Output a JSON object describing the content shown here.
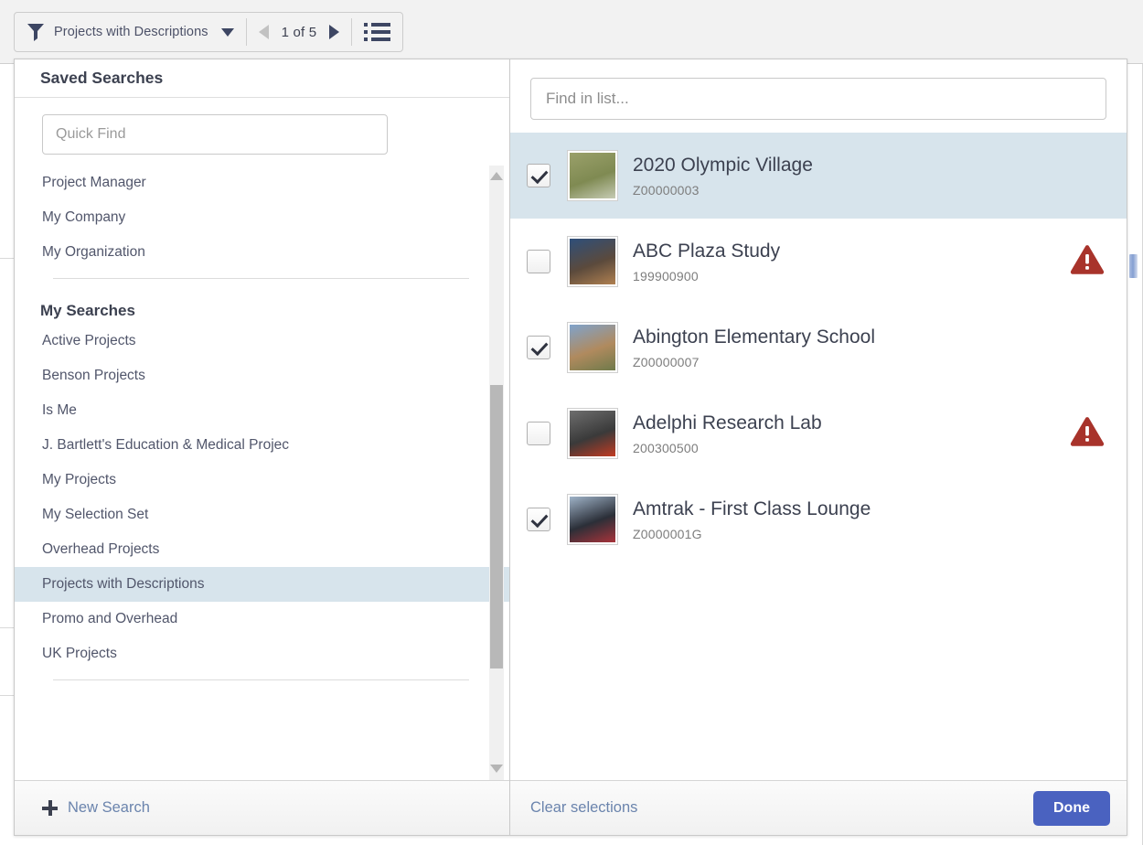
{
  "toolbar": {
    "filter_icon": "funnel-icon",
    "filter_label": "Projects with Descriptions",
    "dropdown_icon": "chevron-down-icon",
    "prev_icon": "triangle-left-icon",
    "page_indicator": "1 of 5",
    "next_icon": "triangle-right-icon",
    "list_view_icon": "list-view-icon"
  },
  "left_panel": {
    "header": "Saved Searches",
    "quick_find_placeholder": "Quick Find",
    "quick_find_value": "",
    "items": [
      {
        "label": "Project Manager",
        "type": "item",
        "selected": false
      },
      {
        "label": "My Company",
        "type": "item",
        "selected": false
      },
      {
        "label": "My Organization",
        "type": "item",
        "selected": false
      },
      {
        "label": "",
        "type": "divider",
        "selected": false
      },
      {
        "label": "My Searches",
        "type": "group",
        "selected": false
      },
      {
        "label": "Active Projects",
        "type": "item",
        "selected": false
      },
      {
        "label": "Benson Projects",
        "type": "item",
        "selected": false
      },
      {
        "label": "Is Me",
        "type": "item",
        "selected": false
      },
      {
        "label": "J. Bartlett's Education & Medical Projec",
        "type": "item",
        "selected": false
      },
      {
        "label": "My Projects",
        "type": "item",
        "selected": false
      },
      {
        "label": "My Selection Set",
        "type": "item",
        "selected": false
      },
      {
        "label": "Overhead Projects",
        "type": "item",
        "selected": false
      },
      {
        "label": "Projects with Descriptions",
        "type": "item",
        "selected": true
      },
      {
        "label": "Promo and Overhead",
        "type": "item",
        "selected": false
      },
      {
        "label": "UK Projects",
        "type": "item",
        "selected": false
      },
      {
        "label": "",
        "type": "divider",
        "selected": false
      }
    ],
    "footer": {
      "icon": "plus-icon",
      "label": "New Search"
    }
  },
  "right_panel": {
    "find_placeholder": "Find in list...",
    "find_value": "",
    "rows": [
      {
        "title": "2020 Olympic Village",
        "id": "Z00000003",
        "checked": true,
        "highlighted": true,
        "warning": false,
        "thumb_colors": [
          "#9aa06a",
          "#7f8a52",
          "#c6cbb4"
        ]
      },
      {
        "title": "ABC Plaza Study",
        "id": "199900900",
        "checked": false,
        "highlighted": false,
        "warning": true,
        "thumb_colors": [
          "#2e4f7a",
          "#5b4a3c",
          "#b08050"
        ]
      },
      {
        "title": "Abington Elementary School",
        "id": "Z00000007",
        "checked": true,
        "highlighted": false,
        "warning": false,
        "thumb_colors": [
          "#7fa3cc",
          "#b08a5e",
          "#6f7a4a"
        ]
      },
      {
        "title": "Adelphi Research Lab",
        "id": "200300500",
        "checked": false,
        "highlighted": false,
        "warning": true,
        "thumb_colors": [
          "#6e6e6e",
          "#3a3a3a",
          "#c23b22"
        ]
      },
      {
        "title": "Amtrak - First Class Lounge",
        "id": "Z0000001G",
        "checked": true,
        "highlighted": false,
        "warning": false,
        "thumb_colors": [
          "#9fb3c8",
          "#2b2f38",
          "#a8333a"
        ]
      }
    ],
    "footer": {
      "clear_label": "Clear selections",
      "done_label": "Done"
    }
  },
  "colors": {
    "accent_blue": "#4a62c0",
    "link_blue": "#6b84ad",
    "selection_blue": "#d7e4ec",
    "warning_red": "#a8332b",
    "icon_navy": "#3d4663",
    "toolbar_bg": "#f2f2f2"
  }
}
